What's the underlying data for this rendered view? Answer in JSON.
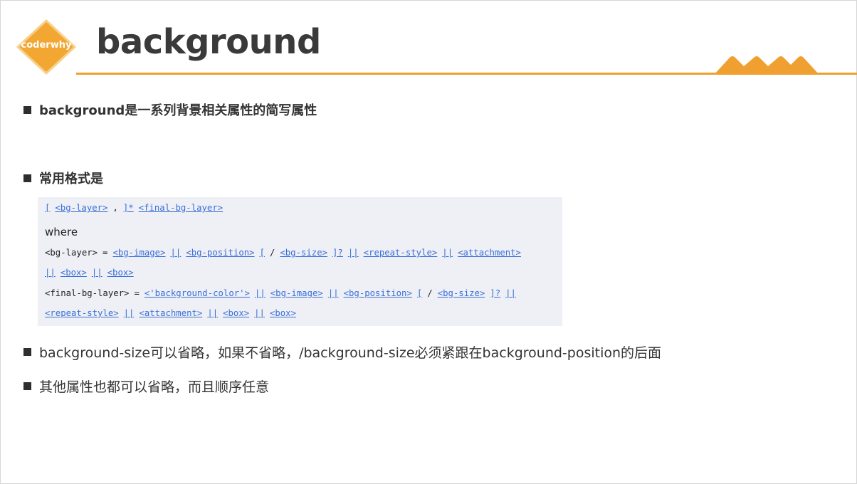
{
  "logo": {
    "text": "coderwhy"
  },
  "title": "background",
  "bullets": {
    "b1": "background是一系列背景相关属性的简写属性",
    "b2": "常用格式是",
    "b3": "background-size可以省略，如果不省略，/background-size必须紧跟在background-position的后面",
    "b4": "其他属性也都可以省略，而且顺序任意"
  },
  "syntax": {
    "line1": [
      {
        "t": "[",
        "link": true
      },
      {
        "t": "<bg-layer>",
        "link": true
      },
      {
        "t": ",",
        "link": false
      },
      {
        "t": "]*",
        "link": true
      },
      {
        "t": "<final-bg-layer>",
        "link": true
      }
    ],
    "where": "where",
    "line2": [
      {
        "t": "<bg-layer>",
        "link": false
      },
      {
        "t": "=",
        "link": false
      },
      {
        "t": "<bg-image>",
        "link": true
      },
      {
        "t": "||",
        "link": true
      },
      {
        "t": "<bg-position>",
        "link": true
      },
      {
        "t": "[",
        "link": true
      },
      {
        "t": "/",
        "link": false
      },
      {
        "t": "<bg-size>",
        "link": true
      },
      {
        "t": "]?",
        "link": true
      },
      {
        "t": "||",
        "link": true
      },
      {
        "t": "<repeat-style>",
        "link": true
      },
      {
        "t": "||",
        "link": true
      },
      {
        "t": "<attachment>",
        "link": true
      }
    ],
    "line3": [
      {
        "t": "||",
        "link": true
      },
      {
        "t": "<box>",
        "link": true
      },
      {
        "t": "||",
        "link": true
      },
      {
        "t": "<box>",
        "link": true
      }
    ],
    "line4": [
      {
        "t": "<final-bg-layer>",
        "link": false
      },
      {
        "t": "=",
        "link": false
      },
      {
        "t": "<'background-color'>",
        "link": true
      },
      {
        "t": "||",
        "link": true
      },
      {
        "t": "<bg-image>",
        "link": true
      },
      {
        "t": "||",
        "link": true
      },
      {
        "t": "<bg-position>",
        "link": true
      },
      {
        "t": "[",
        "link": true
      },
      {
        "t": "/",
        "link": false
      },
      {
        "t": "<bg-size>",
        "link": true
      },
      {
        "t": "]?",
        "link": true
      },
      {
        "t": "||",
        "link": true
      }
    ],
    "line5": [
      {
        "t": "<repeat-style>",
        "link": true
      },
      {
        "t": "||",
        "link": true
      },
      {
        "t": "<attachment>",
        "link": true
      },
      {
        "t": "||",
        "link": true
      },
      {
        "t": "<box>",
        "link": true
      },
      {
        "t": "||",
        "link": true
      },
      {
        "t": "<box>",
        "link": true
      }
    ]
  },
  "colors": {
    "accent": "#f0a030",
    "link": "#3a6fd8",
    "code_bg": "#eef0f6"
  }
}
